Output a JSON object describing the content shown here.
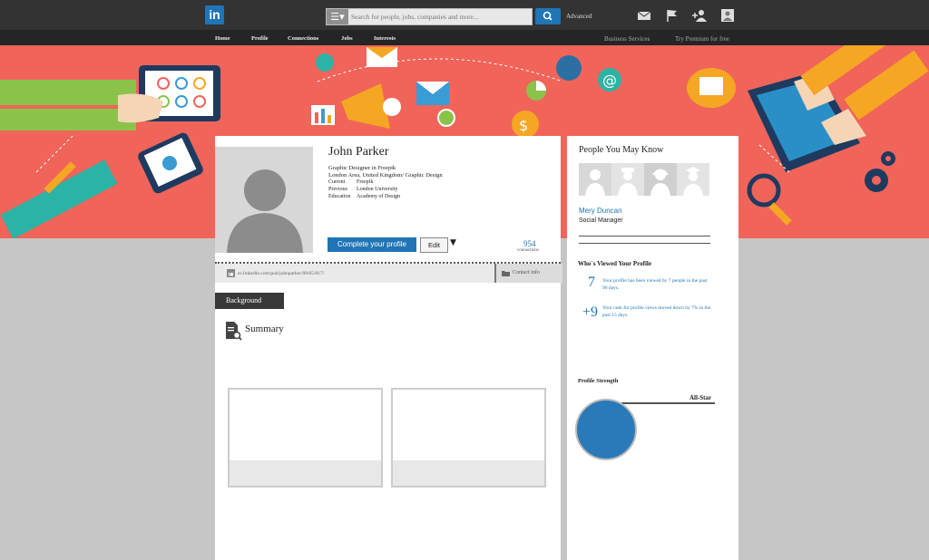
{
  "header": {
    "logo": "in",
    "search_placeholder": "Search for people, jobs, companies and more...",
    "advanced": "Advanced",
    "icons": [
      "menu-icon",
      "search-icon",
      "mail-icon",
      "flag-icon",
      "add-connection-icon",
      "account-icon"
    ]
  },
  "nav": {
    "items": [
      "Home",
      "Profile",
      "Connections",
      "Jobs",
      "Interests"
    ],
    "business": "Business Services",
    "premium": "Try Premium for free"
  },
  "profile": {
    "name": "John Parker",
    "headline": "Graphic Designer in Freepik",
    "location": "London Area, United Kingdom/ Graphic Design",
    "current_label": "Current",
    "current": "Freepik",
    "previous_label": "Previous",
    "previous": "London University",
    "education_label": "Education",
    "education": "Academy of Design",
    "complete_button": "Complete your profile",
    "edit_button": "Edit",
    "connections_count": "954",
    "connections_label": "connections",
    "url": "es.linkedin.com/pub/johnparker/08/65/817/",
    "contact": "Contact info"
  },
  "background": {
    "tab": "Background",
    "summary": "Summary"
  },
  "sidebar": {
    "title": "People You May Know",
    "person_name": "Mery Duncan",
    "person_role": "Social Manager",
    "who_title": "Who`s Viewed Your Profile",
    "views_number": "7",
    "views_text": "Your profile has been viewed by 7 people in the past 90 days.",
    "rank_number": "+9",
    "rank_text": "Your rank for profile views moved down by 7% in the past 15 days.",
    "strength_title": "Profile Strength",
    "strength_level": "All-Star"
  },
  "colors": {
    "brand": "#1f75b6",
    "banner": "#f0645a",
    "topbar": "#333333"
  }
}
